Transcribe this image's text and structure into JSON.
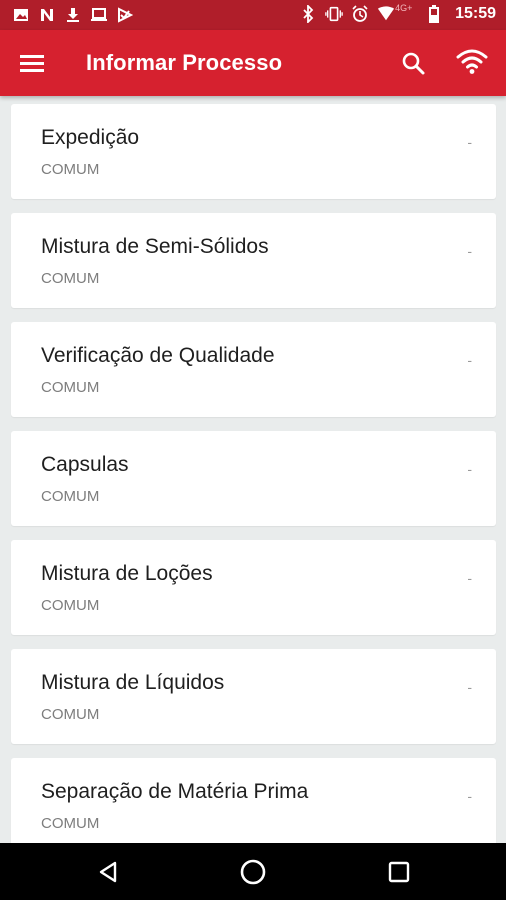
{
  "status_bar": {
    "time": "15:59",
    "network": "4G+",
    "left_icons": [
      "image-icon",
      "n-icon",
      "download-icon",
      "laptop-icon",
      "play-check-icon"
    ],
    "right_icons": [
      "bluetooth-icon",
      "vibrate-icon",
      "alarm-icon",
      "signal-icon",
      "battery-icon"
    ]
  },
  "app_bar": {
    "title": "Informar Processo",
    "icons": [
      "menu-icon",
      "search-icon",
      "wifi-icon"
    ]
  },
  "items": [
    {
      "title": "Expedição",
      "subtitle": "COMUM",
      "trailing": "-"
    },
    {
      "title": "Mistura de Semi-Sólidos",
      "subtitle": "COMUM",
      "trailing": "-"
    },
    {
      "title": "Verificação de Qualidade",
      "subtitle": "COMUM",
      "trailing": "-"
    },
    {
      "title": "Capsulas",
      "subtitle": "COMUM",
      "trailing": "-"
    },
    {
      "title": "Mistura de Loções",
      "subtitle": "COMUM",
      "trailing": "-"
    },
    {
      "title": "Mistura de Líquidos",
      "subtitle": "COMUM",
      "trailing": "-"
    },
    {
      "title": "Separação de Matéria Prima",
      "subtitle": "COMUM",
      "trailing": "-"
    }
  ],
  "nav_bar": {
    "icons": [
      "back-icon",
      "home-icon",
      "recent-apps-icon"
    ]
  },
  "colors": {
    "status_bar": "#b01e2a",
    "app_bar": "#d6212f",
    "background": "#e9ecec",
    "card": "#ffffff"
  }
}
